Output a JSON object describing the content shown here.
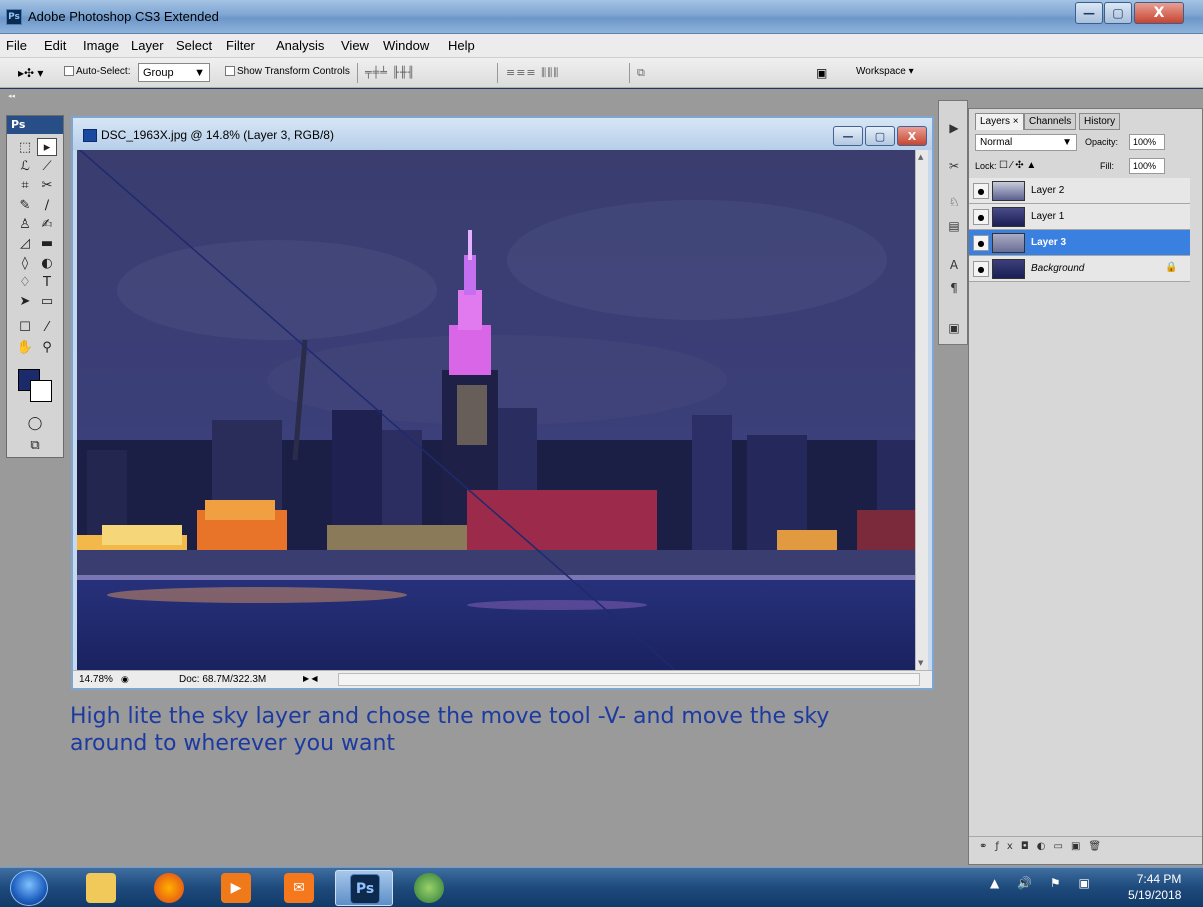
{
  "window": {
    "title": "Adobe Photoshop CS3 Extended",
    "app_badge": "Ps",
    "btn_min": "—",
    "btn_max": "▢",
    "btn_close": "X"
  },
  "menu": [
    "File",
    "Edit",
    "Image",
    "Layer",
    "Select",
    "Filter",
    "Analysis",
    "View",
    "Window",
    "Help"
  ],
  "options": {
    "auto_select_label": "Auto-Select:",
    "auto_select_value": "Group",
    "show_transform_label": "Show Transform Controls",
    "workspace_label": "Workspace ▾"
  },
  "toolbox": {
    "label": "Ps"
  },
  "document": {
    "title": "DSC_1963X.jpg @ 14.8% (Layer 3, RGB/8)",
    "zoom": "14.78%",
    "doc_info": "Doc: 68.7M/322.3M",
    "btn_min": "—",
    "btn_max": "▢",
    "btn_close": "X"
  },
  "annotation": "High lite the sky layer and chose the move tool -V- and move the sky around to wherever you want",
  "layers_panel": {
    "tabs": [
      "Layers ×",
      "Channels",
      "History"
    ],
    "blend_mode": "Normal",
    "opacity_label": "Opacity:",
    "opacity_value": "100%",
    "lock_label": "Lock:",
    "fill_label": "Fill:",
    "fill_value": "100%",
    "layers": [
      {
        "name": "Layer 2",
        "selected": false
      },
      {
        "name": "Layer 1",
        "selected": false
      },
      {
        "name": "Layer 3",
        "selected": true
      },
      {
        "name": "Background",
        "selected": false,
        "locked": true
      }
    ]
  },
  "taskbar": {
    "ps_label": "Ps",
    "time": "7:44 PM",
    "date": "5/19/2018"
  }
}
